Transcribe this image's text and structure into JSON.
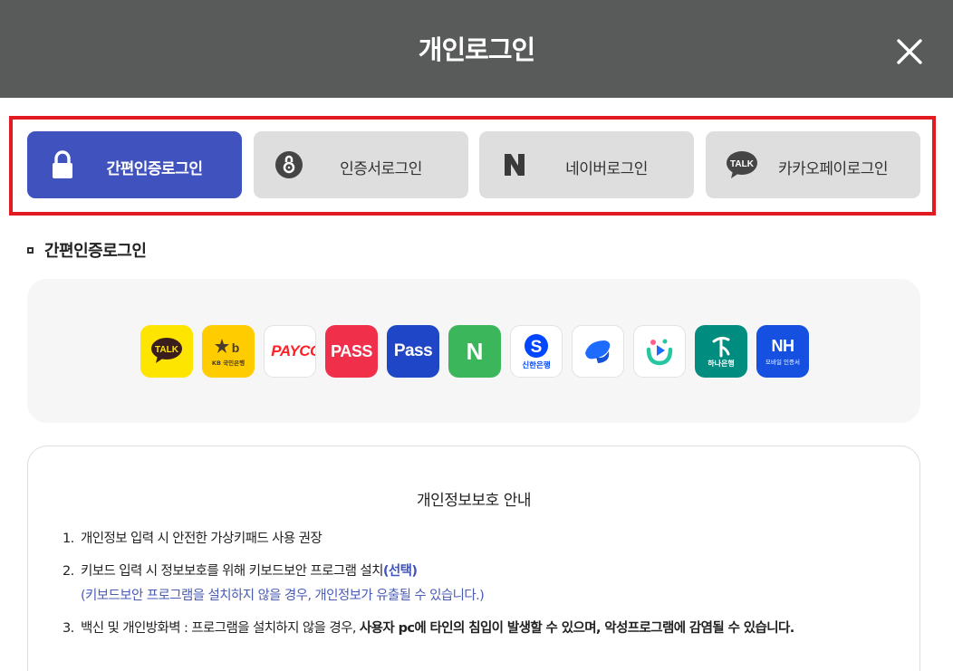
{
  "header": {
    "title": "개인로그인",
    "close_icon": "close-icon"
  },
  "tabs": [
    {
      "label": "간편인증로그인",
      "icon": "lock-icon",
      "active": true
    },
    {
      "label": "인증서로그인",
      "icon": "certificate-icon",
      "active": false
    },
    {
      "label": "네이버로그인",
      "icon": "naver-icon",
      "active": false
    },
    {
      "label": "카카오페이로그인",
      "icon": "kakao-talk-icon",
      "active": false
    }
  ],
  "section": {
    "title": "간편인증로그인"
  },
  "providers": [
    {
      "name": "kakao",
      "logo_text": "TALK",
      "color": "#fee500"
    },
    {
      "name": "kb",
      "logo_text": "KB 국민은행",
      "color": "#ffcc00"
    },
    {
      "name": "payco",
      "logo_text": "PAYCO",
      "color": "#ff1f26"
    },
    {
      "name": "pass-red",
      "logo_text": "PASS",
      "color": "#f0304a"
    },
    {
      "name": "pass-blue",
      "logo_text": "Pass",
      "color": "#2046c8"
    },
    {
      "name": "naver",
      "logo_text": "N",
      "color": "#3cb65a"
    },
    {
      "name": "shinhan",
      "logo_text": "신한은행",
      "color": "#0046ff"
    },
    {
      "name": "toss",
      "logo_text": "",
      "color": "#1e6bff"
    },
    {
      "name": "banksalad",
      "logo_text": "",
      "color": "#26c6a0"
    },
    {
      "name": "hana",
      "logo_text": "하나은행",
      "color": "#008c7e"
    },
    {
      "name": "nh",
      "logo_text": "NH",
      "sub_text": "모바일 인증서",
      "color": "#1550e0"
    }
  ],
  "notice": {
    "title": "개인정보보호 안내",
    "items": [
      {
        "num": "1.",
        "text": "개인정보 입력 시 안전한 가상키패드 사용 권장"
      },
      {
        "num": "2.",
        "text": "키보드 입력 시 정보보호를 위해 키보드보안 프로그램 설치",
        "emph": "(선택)",
        "sub": "(키보드보안 프로그램을 설치하지 않을 경우, 개인정보가 유출될 수 있습니다.)"
      },
      {
        "num": "3.",
        "text": "백신 및 개인방화벽 : 프로그램을 설치하지 않을 경우, ",
        "bold": "사용자 pc에 타인의 침입이 발생할 수 있으며, 악성프로그램에 감염될 수 있습니다."
      }
    ]
  }
}
